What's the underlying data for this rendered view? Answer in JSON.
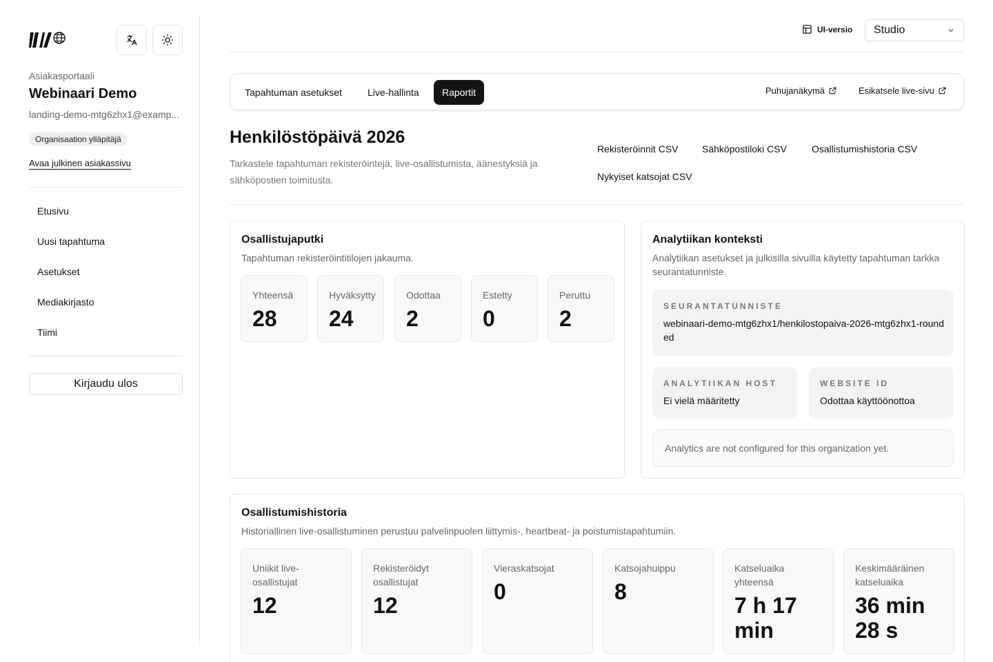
{
  "sidebar": {
    "portal_label": "Asiakasportaali",
    "org_name": "Webinaari Demo",
    "email": "landing-demo-mtg6zhx1@examp...",
    "role_badge": "Organisaation ylläpitäjä",
    "public_link": "Avaa julkinen asiakassivu",
    "nav": [
      {
        "label": "Etusivu"
      },
      {
        "label": "Uusi tapahtuma"
      },
      {
        "label": "Asetukset"
      },
      {
        "label": "Mediakirjasto"
      },
      {
        "label": "Tiimi"
      }
    ],
    "logout": "Kirjaudu ulos"
  },
  "topbar": {
    "ui_version_label": "UI-versio",
    "ui_version_value": "Studio"
  },
  "tabs": {
    "items": [
      {
        "label": "Tapahtuman asetukset",
        "active": false
      },
      {
        "label": "Live-hallinta",
        "active": false
      },
      {
        "label": "Raportit",
        "active": true
      }
    ],
    "speaker_view": "Puhujanäkymä",
    "preview_live": "Esikatsele live-sivu"
  },
  "header": {
    "title": "Henkilöstöpäivä 2026",
    "description": "Tarkastele tapahtuman rekisteröintejä, live-osallistumista, äänestyksiä ja sähköpostien toimitusta.",
    "csv": [
      "Rekisteröinnit CSV",
      "Sähköpostiloki CSV",
      "Osallistumishistoria CSV",
      "Nykyiset katsojat CSV"
    ]
  },
  "pipeline": {
    "title": "Osallistujaputki",
    "subtitle": "Tapahtuman rekisteröintitilojen jakauma.",
    "stats": [
      {
        "label": "Yhteensä",
        "value": "28"
      },
      {
        "label": "Hyväksytty",
        "value": "24"
      },
      {
        "label": "Odottaa",
        "value": "2"
      },
      {
        "label": "Estetty",
        "value": "0"
      },
      {
        "label": "Peruttu",
        "value": "2"
      }
    ]
  },
  "analytics": {
    "title": "Analytiikan konteksti",
    "subtitle": "Analytiikan asetukset ja julkisilla sivuilla käytetty tapahtuman tarkka seurantatunniste.",
    "tracking_label": "SEURANTATUNNISTE",
    "tracking_value": "webinaari-demo-mtg6zhx1/henkilostopaiva-2026-mtg6zhx1-rounded",
    "host_label": "ANALYTIIKAN HOST",
    "host_value": "Ei vielä määritetty",
    "website_label": "WEBSITE ID",
    "website_value": "Odottaa käyttöönottoa",
    "notice": "Analytics are not configured for this organization yet."
  },
  "history": {
    "title": "Osallistumishistoria",
    "subtitle": "Historiallinen live-osallistuminen perustuu palvelinpuolen liittymis-, heartbeat- ja poistumistapahtumiin.",
    "stats": [
      {
        "label": "Uniikit live-osallistujat",
        "value": "12"
      },
      {
        "label": "Rekisteröidyt osallistujat",
        "value": "12"
      },
      {
        "label": "Vieraskatsojat",
        "value": "0"
      },
      {
        "label": "Katsojahuippu",
        "value": "8"
      },
      {
        "label": "Katseluaika yhteensä",
        "value": "7 h 17 min"
      },
      {
        "label": "Keskimääräinen katseluaika",
        "value": "36 min 28 s"
      }
    ]
  }
}
